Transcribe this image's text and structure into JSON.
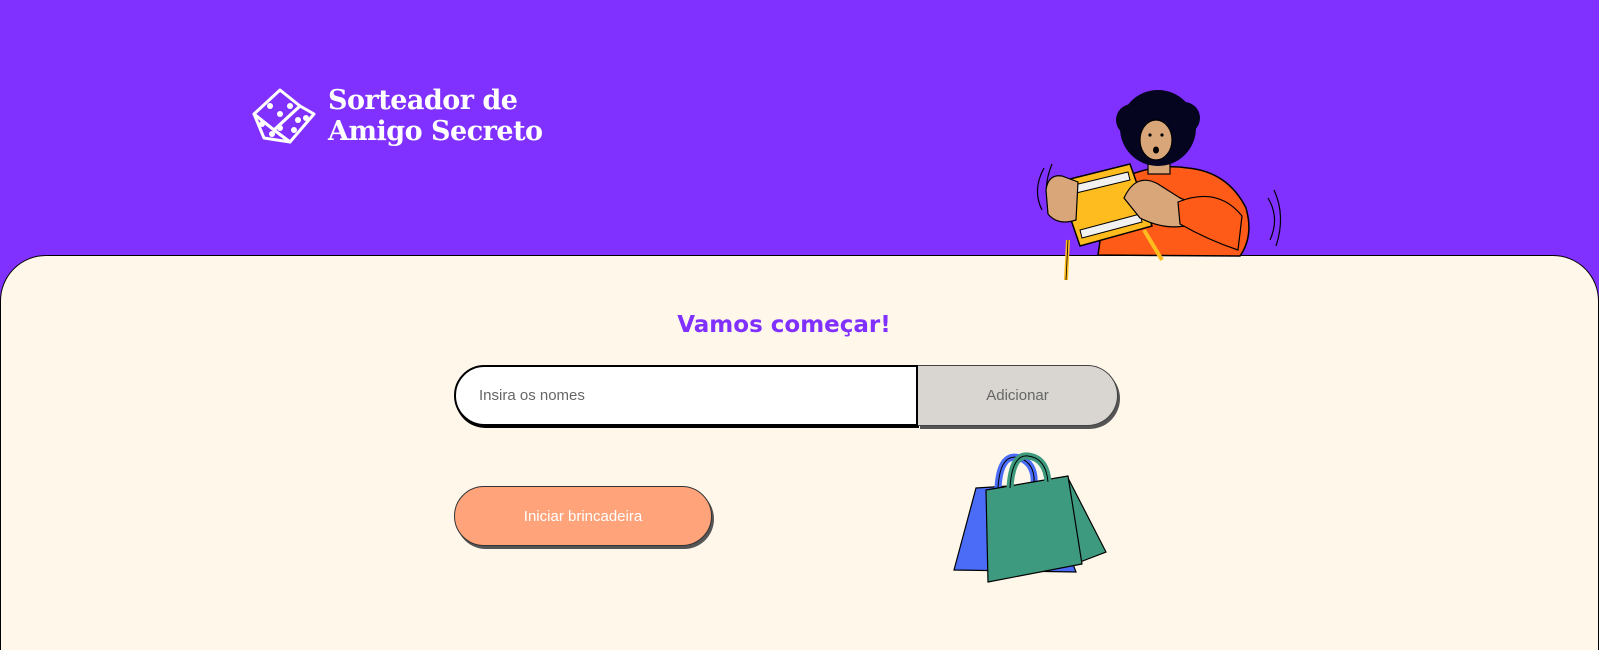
{
  "header": {
    "logo_line1": "Sorteador de",
    "logo_line2": "Amigo Secreto",
    "logo_icon": "dice-icon",
    "illustration": "person-holding-gift-illustration"
  },
  "main": {
    "title": "Vamos começar!",
    "name_input": {
      "value": "",
      "placeholder": "Insira os nomes"
    },
    "add_button_label": "Adicionar",
    "start_button_label": "Iniciar brincadeira",
    "decoration": "shopping-bags-illustration"
  },
  "colors": {
    "brand_purple": "#8031FF",
    "panel_background": "#FFF8EA",
    "start_button": "#FFA37A",
    "add_button": "#D9D6D1"
  }
}
